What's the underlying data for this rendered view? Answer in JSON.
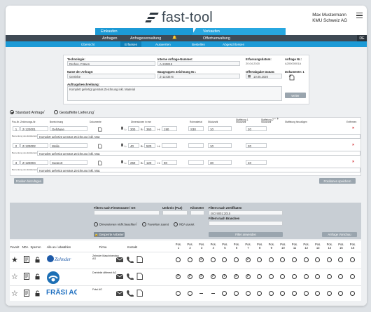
{
  "app": {
    "name": "fast-tool"
  },
  "user": {
    "name": "Max Mustermann",
    "company": "KMU Schweiz AG"
  },
  "nav": {
    "group1": "Einkaufen",
    "group2": "Verkaufen",
    "sub": [
      "Anfragen",
      "Anfrageverwaltung",
      "Offertverwaltung"
    ],
    "lang": "DE",
    "steps": [
      "Übersicht",
      "Erfassen",
      "Auswerten",
      "Bestellen",
      "Abgeschlossen"
    ]
  },
  "form": {
    "technologie_label": "Technologie:",
    "technologie_value": "Drehen, Fräsen",
    "anfrage_nummer_label": "Interne Anfrage-Nummer:",
    "anfrage_nummer_value": "A-240615",
    "erfassungsdatum_label": "Erfassungsdatum:",
    "erfassungsdatum_value": "20.04.2020",
    "anfrage_nr_label": "Anfrage Nr.:",
    "anfrage_nr_value": "A20000001A",
    "name_label": "Name der Anfrage:",
    "name_value": "Getriebe",
    "baugruppen_label": "Baugruppen Zeichnung Nr.:",
    "baugruppen_value": "Z-12434-B",
    "offertabgabe_label": "Offertabgabe Datum:",
    "offertabgabe_value": "10.05.2020",
    "dokumente_label": "Dokumente: 1",
    "beschreibung_label": "Auftragsbeschreibung:",
    "beschreibung_value": "Komplett gefertigt gemäss Zeichnung inkl. Material",
    "weiter": "weiter"
  },
  "options": {
    "standard": "Standard Anfrage",
    "gestaffelt": "Gestaffelte Lieferung"
  },
  "table": {
    "headers": [
      "Pos-Nr.",
      "Zeichnungs-Nr.",
      "Bezeichnung",
      "Dokumente",
      "Dimensionen in mm",
      "Rohmaterial",
      "Stückzahl",
      "Staffelung 1",
      "Staffelung 2",
      "Staffelung hinzufügen",
      "Entfernen"
    ],
    "bemerkung_label": "Bemerkung des Einkäufers",
    "rows": [
      {
        "pos": "1",
        "nr": "Z-123001",
        "name": "Gehäuse",
        "l": "300",
        "b": "360",
        "h": "190",
        "mat": "S30",
        "qty": "10",
        "st2": "20",
        "note": "Komplett gefertigt gemäss Zeichnung inkl. Mat."
      },
      {
        "pos": "2",
        "nr": "Z-123002",
        "name": "Welle",
        "l": "40",
        "b": "520",
        "h": "",
        "mat": "",
        "qty": "10",
        "st2": "20",
        "note": "Komplett gefertigt gemäss Zeichnung inkl. Mat."
      },
      {
        "pos": "3",
        "nr": "Z-123004",
        "name": "Support",
        "l": "250",
        "b": "120",
        "h": "90",
        "mat": "",
        "qty": "30",
        "st2": "40",
        "note": "Komplett gefertigt gemäss Zeichnung inkl. Mat."
      }
    ],
    "add_position": "Position hinzufügen",
    "save_positions": "Positionen speichern"
  },
  "filter": {
    "firmenname": "Filtern nach Firmenname / Ort",
    "umkreis": "Umkreis (PLZ)",
    "kilometer": "Kilometer",
    "zertifikaten": "Filtern nach Zertifikaten",
    "zertifikat_value": "ISO 9001:2015",
    "branchen": "Filtern nach Branchen",
    "dim_ignore": "Dimensionen nicht beachten",
    "favoriten": "Favoriten zuerst",
    "nda": "NDA zuerst",
    "gesperrte": "Gesperrte Anbieter",
    "anwenden": "Filter anwenden",
    "vorschau": "Anfrage Vorschau"
  },
  "suppliers": {
    "headers": {
      "favorit": "Favorit",
      "nda": "NDA",
      "sperren": "Sperren",
      "alle": "Alle an-/ abwählen",
      "firma": "Firma",
      "kontakt": "Kontakt",
      "pos": "Pos."
    },
    "positions": [
      "1",
      "2",
      "3",
      "4",
      "5",
      "6",
      "7",
      "8",
      "9",
      "10",
      "11",
      "12",
      "13",
      "14",
      "15",
      "16"
    ],
    "rows": [
      {
        "name": "Zehnder Maschinenbau AG",
        "logo": "Zehnder",
        "favorite": true,
        "marks": [
          "o",
          "o",
          "ok",
          "o",
          "o",
          "o",
          "ok",
          "o",
          "o",
          "o",
          "o",
          "o",
          "o",
          "o",
          "o",
          "o"
        ]
      },
      {
        "name": "Drehteile different AG",
        "logo": "drehteile",
        "favorite": false,
        "marks": [
          "ok",
          "ok",
          "ok",
          "ok",
          "ok",
          "ok",
          "ok",
          "o",
          "o",
          "o",
          "o",
          "o",
          "o",
          "o",
          "o",
          "o"
        ]
      },
      {
        "name": "Fräsi AG",
        "logo": "FRÄSI AG",
        "favorite": false,
        "marks": [
          "o",
          "o",
          "-",
          "-",
          "o",
          "o",
          "o",
          "o",
          "o",
          "o",
          "o",
          "o",
          "o",
          "o",
          "o",
          "o"
        ]
      }
    ]
  }
}
